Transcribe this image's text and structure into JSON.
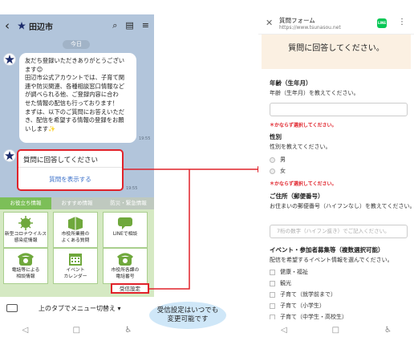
{
  "left": {
    "header": {
      "back": "‹",
      "title": "田辺市",
      "icons": [
        "search-icon",
        "note-icon",
        "menu-icon"
      ]
    },
    "chat": {
      "date": "今日",
      "message_lines": [
        "友だち登録いただきありがとうござい",
        "ます😊",
        "田辺市公式アカウントでは、子育て関",
        "連や防災関連、各種相談窓口情報など",
        "が調べられる他、ご登録内容に合わ",
        "せた情報の配信も行っております！",
        "まずは、以下のご質問にお答えいただ",
        "き、配信を希望する情報の登録をお願",
        "いします✨"
      ],
      "message_time": "19:55",
      "card_question": "質問に回答してください",
      "card_action": "質問を表示する",
      "card_time": "19:55"
    },
    "menu": {
      "tabs": [
        "お役立ち情報",
        "おすすめ情報",
        "防災・緊急情報"
      ],
      "cells": [
        {
          "label": "新型コロナウイルス\n感染症情報",
          "icon": "virus-icon"
        },
        {
          "label": "市役所業務の\nよくある質問",
          "icon": "book-icon"
        },
        {
          "label": "LINEで相談",
          "icon": "chat-icon"
        },
        {
          "label": "電話等による\n相談情報",
          "icon": "phone-icon"
        },
        {
          "label": "イベント\nカレンダー",
          "icon": "calendar-icon"
        },
        {
          "label": "市役所各課の\n電話番号",
          "icon": "phone-icon"
        }
      ],
      "settings_button": "受信設定"
    },
    "bottom_text": "上のタブでメニュー切替え ▾"
  },
  "annotation": {
    "note": "受信設定はいつでも\n変更可能です"
  },
  "right": {
    "header": {
      "title": "質問フォーム",
      "url": "https://www.tsunasou.net",
      "line_badge": "LINE"
    },
    "form_title": "質問に回答してください。",
    "age": {
      "title": "年齢（生年月）",
      "desc": "年齢（生年月）を教えてください。",
      "required": "＊かならず選択してください。"
    },
    "gender": {
      "title": "性別",
      "desc": "性別を教えてください。",
      "options": [
        "男",
        "女"
      ],
      "required": "＊かならず選択してください。"
    },
    "address": {
      "title": "ご住所（郵便番号）",
      "desc": "お住まいの郵便番号（ハイフンなし）を教えてください。",
      "placeholder": "7桁の数字（ハイフン抜き）でご記入ください。"
    },
    "events": {
      "title": "イベント・参加者募集等（複数選択可能）",
      "desc": "配信を希望するイベント情報を選んでください。",
      "options": [
        "健康・福祉",
        "観光",
        "子育て（就学前まで）",
        "子育て（小学生）",
        "子育て（中学生・高校生）"
      ]
    }
  },
  "colors": {
    "chat_bg": "#b2c5db",
    "menu_bg": "#d5e9c3",
    "accent_red": "#e0222a",
    "line_green": "#06c755",
    "form_bg": "#fbf0e2"
  }
}
